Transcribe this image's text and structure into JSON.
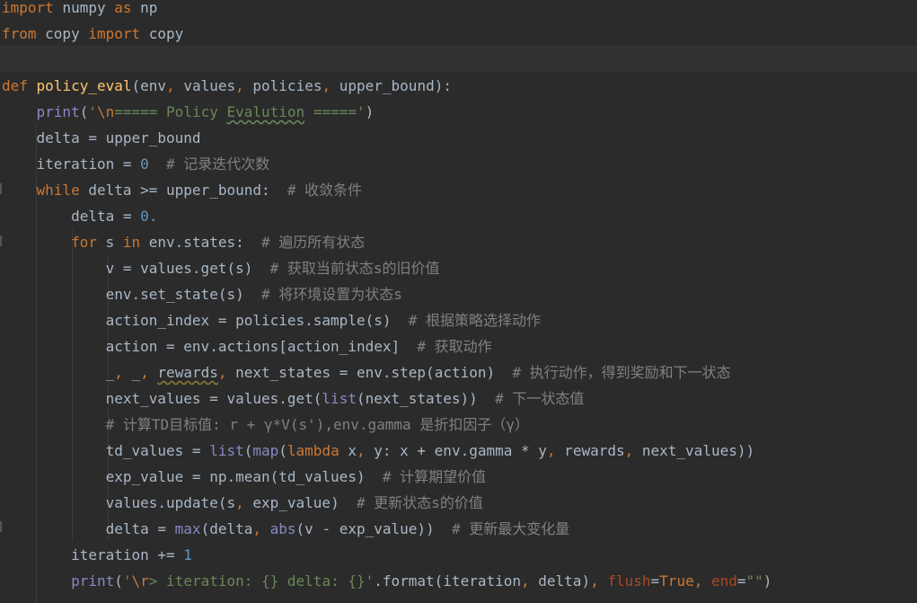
{
  "editor": {
    "language": "python",
    "theme": "darcula",
    "lines": [
      [
        {
          "t": "import",
          "c": "kw"
        },
        {
          "t": " numpy ",
          "c": "op"
        },
        {
          "t": "as",
          "c": "kw"
        },
        {
          "t": " np",
          "c": "op"
        }
      ],
      [
        {
          "t": "from",
          "c": "kw"
        },
        {
          "t": " copy ",
          "c": "op"
        },
        {
          "t": "import",
          "c": "kw"
        },
        {
          "t": " copy",
          "c": "op"
        }
      ],
      [],
      [
        {
          "t": "def",
          "c": "kw"
        },
        {
          "t": " ",
          "c": "op"
        },
        {
          "t": "policy_eval",
          "c": "fn"
        },
        {
          "t": "(env",
          "c": "op"
        },
        {
          "t": ",",
          "c": "kw"
        },
        {
          "t": " values",
          "c": "op"
        },
        {
          "t": ",",
          "c": "kw"
        },
        {
          "t": " policies",
          "c": "op"
        },
        {
          "t": ",",
          "c": "kw"
        },
        {
          "t": " upper_bound):",
          "c": "op"
        }
      ],
      [
        {
          "t": "    ",
          "c": "op"
        },
        {
          "t": "print",
          "c": "bi"
        },
        {
          "t": "(",
          "c": "op"
        },
        {
          "t": "'",
          "c": "str"
        },
        {
          "t": "\\n",
          "c": "esc"
        },
        {
          "t": "===== Policy ",
          "c": "str"
        },
        {
          "t": "Evalution",
          "c": "str",
          "u": "typo"
        },
        {
          "t": " ====='",
          "c": "str"
        },
        {
          "t": ")",
          "c": "op"
        }
      ],
      [
        {
          "t": "    delta = upper_bound",
          "c": "op"
        }
      ],
      [
        {
          "t": "    iteration = ",
          "c": "op"
        },
        {
          "t": "0",
          "c": "num"
        },
        {
          "t": "  # 记录迭代次数",
          "c": "cm"
        }
      ],
      [
        {
          "t": "    ",
          "c": "op"
        },
        {
          "t": "while",
          "c": "kw"
        },
        {
          "t": " delta >= upper_bound:",
          "c": "op"
        },
        {
          "t": "  # 收敛条件",
          "c": "cm"
        }
      ],
      [
        {
          "t": "        delta = ",
          "c": "op"
        },
        {
          "t": "0.",
          "c": "num"
        }
      ],
      [
        {
          "t": "        ",
          "c": "op"
        },
        {
          "t": "for",
          "c": "kw"
        },
        {
          "t": " s ",
          "c": "op"
        },
        {
          "t": "in",
          "c": "kw"
        },
        {
          "t": " env.states:",
          "c": "op"
        },
        {
          "t": "  # 遍历所有状态",
          "c": "cm"
        }
      ],
      [
        {
          "t": "            v = values.get(s)",
          "c": "op"
        },
        {
          "t": "  # 获取当前状态s的旧价值",
          "c": "cm"
        }
      ],
      [
        {
          "t": "            env.set_state(s)",
          "c": "op"
        },
        {
          "t": "  # 将环境设置为状态s",
          "c": "cm"
        }
      ],
      [
        {
          "t": "            action_index = policies.sample(s)",
          "c": "op"
        },
        {
          "t": "  # 根据策略选择动作",
          "c": "cm"
        }
      ],
      [
        {
          "t": "            action = env.actions[action_index]",
          "c": "op"
        },
        {
          "t": "  # 获取动作",
          "c": "cm"
        }
      ],
      [
        {
          "t": "            _",
          "c": "op"
        },
        {
          "t": ",",
          "c": "kw"
        },
        {
          "t": " _",
          "c": "op"
        },
        {
          "t": ",",
          "c": "kw"
        },
        {
          "t": " ",
          "c": "op"
        },
        {
          "t": "rewards",
          "c": "op",
          "u": "warn"
        },
        {
          "t": ",",
          "c": "kw"
        },
        {
          "t": " next_states = env.step(action)",
          "c": "op"
        },
        {
          "t": "  # 执行动作，得到奖励和下一状态",
          "c": "cm"
        }
      ],
      [
        {
          "t": "            next_values = values.get(",
          "c": "op"
        },
        {
          "t": "list",
          "c": "bi"
        },
        {
          "t": "(next_states))",
          "c": "op"
        },
        {
          "t": "  # 下一状态值",
          "c": "cm"
        }
      ],
      [
        {
          "t": "            # 计算TD目标值: r + γ*V(s'),env.gamma 是折扣因子（γ）",
          "c": "cm"
        }
      ],
      [
        {
          "t": "            td_values = ",
          "c": "op"
        },
        {
          "t": "list",
          "c": "bi"
        },
        {
          "t": "(",
          "c": "op"
        },
        {
          "t": "map",
          "c": "bi"
        },
        {
          "t": "(",
          "c": "op"
        },
        {
          "t": "lambda",
          "c": "kw"
        },
        {
          "t": " x",
          "c": "op"
        },
        {
          "t": ",",
          "c": "kw"
        },
        {
          "t": " y: x + env.gamma * y",
          "c": "op"
        },
        {
          "t": ",",
          "c": "kw"
        },
        {
          "t": " rewards",
          "c": "op"
        },
        {
          "t": ",",
          "c": "kw"
        },
        {
          "t": " next_values))",
          "c": "op"
        }
      ],
      [
        {
          "t": "            exp_value = np.mean(td_values)",
          "c": "op"
        },
        {
          "t": "  # 计算期望价值",
          "c": "cm"
        }
      ],
      [
        {
          "t": "            values.update(s",
          "c": "op"
        },
        {
          "t": ",",
          "c": "kw"
        },
        {
          "t": " exp_value)",
          "c": "op"
        },
        {
          "t": "  # 更新状态s的价值",
          "c": "cm"
        }
      ],
      [
        {
          "t": "            delta = ",
          "c": "op"
        },
        {
          "t": "max",
          "c": "bi"
        },
        {
          "t": "(delta",
          "c": "op"
        },
        {
          "t": ",",
          "c": "kw"
        },
        {
          "t": " ",
          "c": "op"
        },
        {
          "t": "abs",
          "c": "bi"
        },
        {
          "t": "(v - exp_value))",
          "c": "op"
        },
        {
          "t": "  # 更新最大变化量",
          "c": "cm"
        }
      ],
      [
        {
          "t": "        iteration += ",
          "c": "op"
        },
        {
          "t": "1",
          "c": "num"
        }
      ],
      [
        {
          "t": "        ",
          "c": "op"
        },
        {
          "t": "print",
          "c": "bi"
        },
        {
          "t": "(",
          "c": "op"
        },
        {
          "t": "'",
          "c": "str"
        },
        {
          "t": "\\r",
          "c": "esc"
        },
        {
          "t": "> iteration: {} delta: {}'",
          "c": "str"
        },
        {
          "t": ".format(iteration",
          "c": "op"
        },
        {
          "t": ",",
          "c": "kw"
        },
        {
          "t": " delta)",
          "c": "op"
        },
        {
          "t": ",",
          "c": "kw"
        },
        {
          "t": " ",
          "c": "op"
        },
        {
          "t": "flush",
          "c": "kwarg"
        },
        {
          "t": "=",
          "c": "op"
        },
        {
          "t": "True",
          "c": "kw"
        },
        {
          "t": ",",
          "c": "kw"
        },
        {
          "t": " ",
          "c": "op"
        },
        {
          "t": "end",
          "c": "kwarg"
        },
        {
          "t": "=",
          "c": "op"
        },
        {
          "t": "\"\"",
          "c": "str"
        },
        {
          "t": ")",
          "c": "op"
        }
      ]
    ]
  }
}
